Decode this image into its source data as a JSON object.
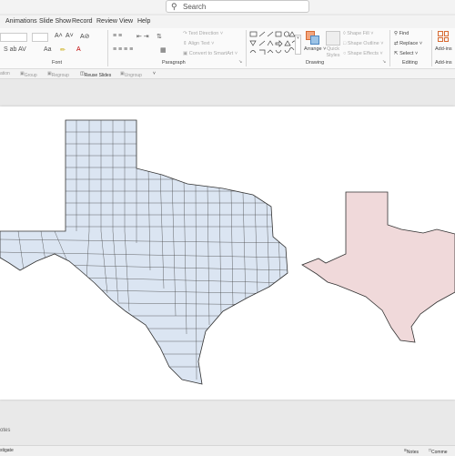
{
  "search": {
    "placeholder": "Search"
  },
  "tabs": [
    "Animations",
    "Slide Show",
    "Record",
    "Review",
    "View",
    "Help"
  ],
  "ribbon": {
    "groups": {
      "font": "Font",
      "paragraph": "Paragraph",
      "drawing": "Drawing",
      "editing": "Editing",
      "addins": "Add-ins"
    },
    "paragraph_buttons": {
      "text_direction": "Text Direction",
      "align_text": "Align Text",
      "convert_smartart": "Convert to SmartArt"
    },
    "drawing_buttons": {
      "arrange": "Arrange",
      "quick_styles": "Quick Styles",
      "shape_fill": "Shape Fill",
      "shape_outline": "Shape Outline",
      "shape_effects": "Shape Effects"
    },
    "editing_buttons": {
      "find": "Find",
      "replace": "Replace",
      "select": "Select"
    },
    "addins_button": "Add-ins"
  },
  "subbar": {
    "layout": "ation",
    "group": "Group",
    "regroup": "Regroup",
    "reuse": "Reuse Slides",
    "ungroup": "Ungroup"
  },
  "notes_label": "otes",
  "status": {
    "left": "stigate",
    "notes": "Notes",
    "comments": "Comme"
  },
  "colors": {
    "county_fill": "#dbe5f2",
    "county_stroke": "#333333",
    "outline_fill": "#f0d9da",
    "outline_stroke": "#333333",
    "slide_bg": "#ffffff",
    "workspace_bg": "#e9e9e9"
  }
}
